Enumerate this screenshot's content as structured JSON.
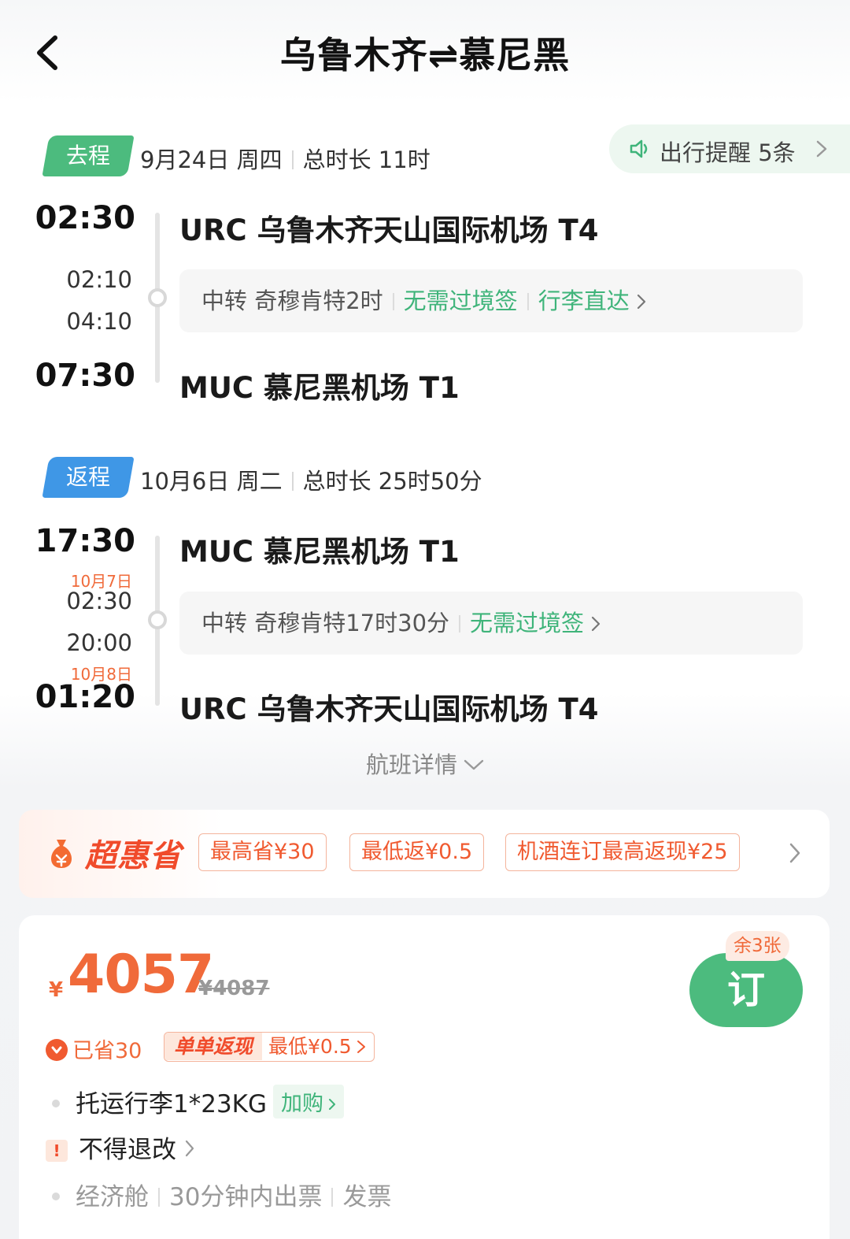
{
  "header": {
    "title": "乌鲁木齐⇌慕尼黑"
  },
  "reminder": {
    "label": "出行提醒 5条"
  },
  "outbound": {
    "tag": "去程",
    "date": "9月24日 周四",
    "duration": "总时长 11时",
    "depart_time": "02:30",
    "arrive_transfer_time": "02:10",
    "depart_transfer_time": "04:10",
    "arrive_time": "07:30",
    "depart_airport": "URC 乌鲁木齐天山国际机场 T4",
    "arrive_airport": "MUC 慕尼黑机场 T1",
    "transfer_text": "中转 奇穆肯特2时",
    "transfer_visa": "无需过境签",
    "transfer_baggage": "行李直达"
  },
  "return": {
    "tag": "返程",
    "date": "10月6日 周二",
    "duration": "总时长 25时50分",
    "depart_time": "17:30",
    "arrive_transfer_date": "10月7日",
    "arrive_transfer_time": "02:30",
    "depart_transfer_time": "20:00",
    "arrive_date": "10月8日",
    "arrive_time": "01:20",
    "depart_airport": "MUC 慕尼黑机场 T1",
    "arrive_airport": "URC 乌鲁木齐天山国际机场 T4",
    "transfer_text": "中转 奇穆肯特17时30分",
    "transfer_visa": "无需过境签"
  },
  "flight_details_link": "航班详情",
  "promo": {
    "brand": "超惠省",
    "coupons": [
      "最高省¥30",
      "最低返¥0.5",
      "机酒连订最高返现¥25"
    ]
  },
  "booking": {
    "currency": "¥",
    "price": "4057",
    "original_price": "¥4087",
    "tickets_left": "余3张",
    "book_label": "订",
    "saved": "已省30",
    "cashback_label": "单单返现",
    "cashback_value": "最低¥0.5",
    "baggage": "托运行李1*23KG",
    "baggage_addon": "加购",
    "refund_policy": "不得退改",
    "cabin": "经济舱",
    "ticketing": "30分钟内出票",
    "invoice": "发票"
  },
  "colors": {
    "green": "#4cbb7e",
    "blue": "#3f97e6",
    "orange": "#f06a3a"
  }
}
